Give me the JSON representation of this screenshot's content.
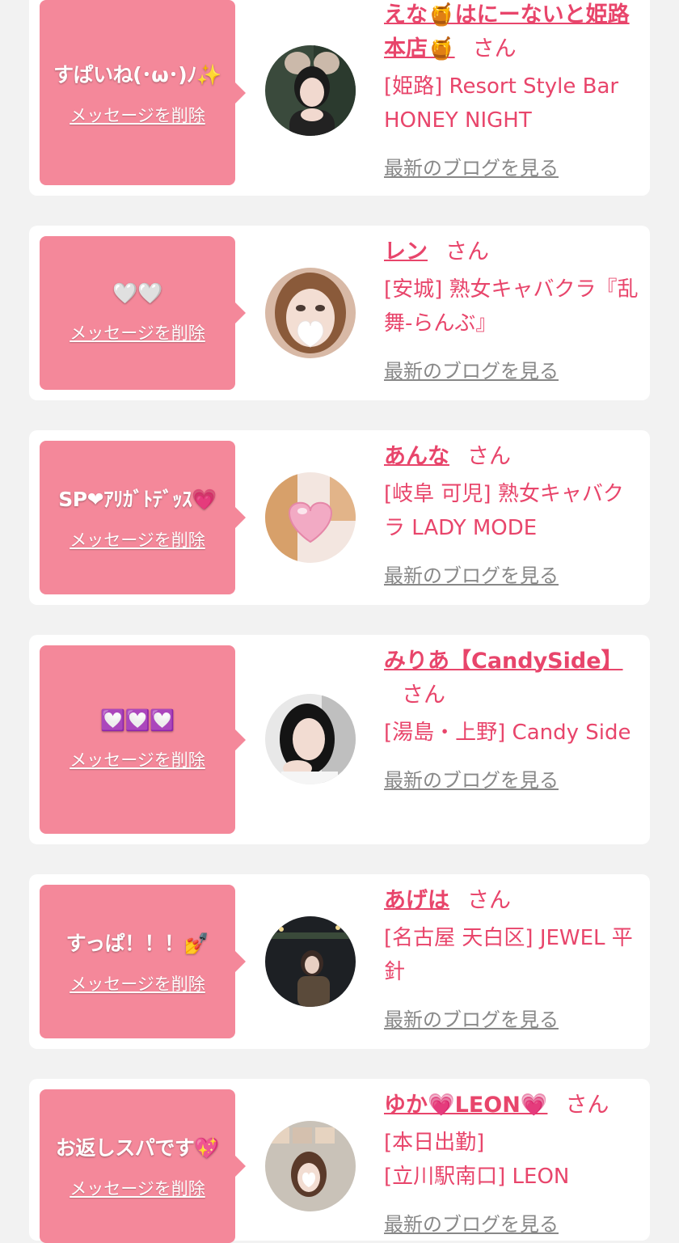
{
  "cards": [
    {
      "message": "すぱいね(･ω･)ﾉ✨",
      "delete_label": "メッセージを削除",
      "avatar_icon": "girl-with-cat-ears-avatar",
      "name": "えな🍯はにーないと姫路本店🍯",
      "san": "さん",
      "shop": "[姫路] Resort Style Bar HONEY NIGHT",
      "blog_label": "最新のブログを見る"
    },
    {
      "message": "🤍🤍",
      "delete_label": "メッセージを削除",
      "avatar_icon": "girl-heart-face-avatar",
      "name": "レン",
      "san": "さん",
      "shop": "[安城] 熟女キャバクラ『乱舞-らんぶ』",
      "blog_label": "最新のブログを見る"
    },
    {
      "message": "SP❤ｱﾘｶﾞﾄﾃﾞｯｽ💗",
      "delete_label": "メッセージを削除",
      "avatar_icon": "pink-heart-avatar",
      "name": "あんな",
      "san": "さん",
      "shop": "[岐阜 可児] 熟女キャバクラ LADY MODE",
      "blog_label": "最新のブログを見る"
    },
    {
      "message": "💟💟💟",
      "delete_label": "メッセージを削除",
      "avatar_icon": "girl-dark-hair-avatar",
      "name": "みりあ【CandySide】",
      "san": "さん",
      "shop": "[湯島・上野] Candy Side",
      "blog_label": "最新のブログを見る"
    },
    {
      "message": "すっぱ！！！💅",
      "delete_label": "メッセージを削除",
      "avatar_icon": "girl-night-street-avatar",
      "name": "あげは",
      "san": "さん",
      "shop": "[名古屋 天白区] JEWEL 平針",
      "blog_label": "最新のブログを見る"
    },
    {
      "message": "お返しスパです💖",
      "delete_label": "メッセージを削除",
      "avatar_icon": "girl-mirror-selfie-avatar",
      "name": "ゆか💗LEON💗",
      "san": "さん",
      "shop": "[本日出勤]\n[立川駅南口] LEON",
      "blog_label": "最新のブログを見る"
    }
  ],
  "colors": {
    "accent": "#e8456b",
    "bubble": "#f4889a",
    "page_bg": "#f2f2f2",
    "link_gray": "#888888"
  }
}
